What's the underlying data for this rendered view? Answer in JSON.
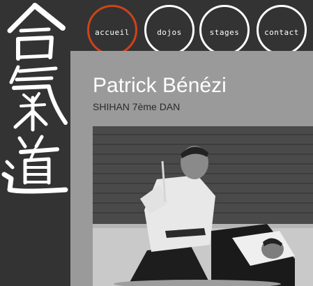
{
  "nav": {
    "items": [
      {
        "label": "accueil",
        "active": true
      },
      {
        "label": "dojos",
        "active": false
      },
      {
        "label": "stages",
        "active": false
      },
      {
        "label": "contact",
        "active": false
      }
    ]
  },
  "main": {
    "title": "Patrick Bénézi",
    "subtitle": "SHIHAN 7ème DAN"
  },
  "colors": {
    "background": "#333333",
    "panel": "#9a9a9a",
    "accent_active": "#d0421a",
    "nav_border": "#ffffff"
  },
  "icons": {
    "logo": "aikido-calligraphy-logo"
  }
}
